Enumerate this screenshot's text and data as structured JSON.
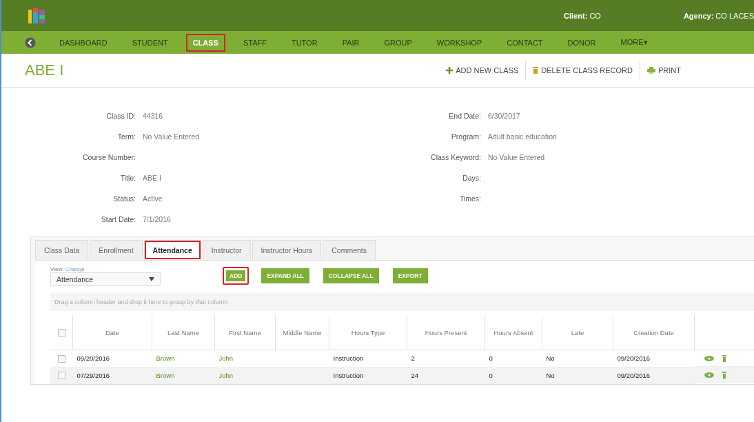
{
  "header": {
    "client_label": "Client:",
    "client": "CO",
    "agency_label": "Agency:",
    "agency": "CO LACES"
  },
  "nav": [
    {
      "label": "DASHBOARD",
      "selected": false,
      "highlighted": false
    },
    {
      "label": "STUDENT",
      "selected": false,
      "highlighted": false
    },
    {
      "label": "CLASS",
      "selected": true,
      "highlighted": true
    },
    {
      "label": "STAFF",
      "selected": false,
      "highlighted": false
    },
    {
      "label": "TUTOR",
      "selected": false,
      "highlighted": false
    },
    {
      "label": "PAIR",
      "selected": false,
      "highlighted": false
    },
    {
      "label": "GROUP",
      "selected": false,
      "highlighted": false
    },
    {
      "label": "WORKSHOP",
      "selected": false,
      "highlighted": false
    },
    {
      "label": "CONTACT",
      "selected": false,
      "highlighted": false
    },
    {
      "label": "DONOR",
      "selected": false,
      "highlighted": false
    },
    {
      "label": "MORE",
      "selected": false,
      "highlighted": false,
      "caret": "▾"
    }
  ],
  "page_title": "ABE I",
  "actions": [
    {
      "kind": "add",
      "label": "ADD NEW CLASS"
    },
    {
      "kind": "delete",
      "label": "DELETE CLASS RECORD"
    },
    {
      "kind": "print",
      "label": "PRINT"
    }
  ],
  "details_left": [
    {
      "label": "Class ID:",
      "value": "44316"
    },
    {
      "label": "Term:",
      "value": "No Value Entered"
    },
    {
      "label": "Course Number:"
    },
    {
      "label": "Title:",
      "value": "ABE I"
    },
    {
      "label": "Status:",
      "value": "Active"
    },
    {
      "label": "Start Date:",
      "value": "7/1/2016"
    }
  ],
  "details_right": [
    {
      "label": "End Date:",
      "value": "6/30/2017"
    },
    {
      "label": "Program:",
      "value": "Adult basic education"
    },
    {
      "label": "Class Keyword:",
      "value": "No Value Entered"
    },
    {
      "label": "Days:"
    },
    {
      "label": "Times:"
    }
  ],
  "tabs": [
    {
      "label": "Class Data",
      "selected": false,
      "highlighted": false
    },
    {
      "label": "Enrollment",
      "selected": false,
      "highlighted": false
    },
    {
      "label": "Attendance",
      "selected": true,
      "highlighted": true
    },
    {
      "label": "Instructor",
      "selected": false,
      "highlighted": false
    },
    {
      "label": "Instructor Hours",
      "selected": false,
      "highlighted": false
    },
    {
      "label": "Comments",
      "selected": false,
      "highlighted": false
    }
  ],
  "view": {
    "label": "View:",
    "link": "Change",
    "value": "Attendance"
  },
  "buttons": [
    {
      "label": "ADD",
      "highlighted": true
    },
    {
      "label": "EXPAND ALL",
      "highlighted": false
    },
    {
      "label": "COLLAPSE ALL",
      "highlighted": false
    },
    {
      "label": "EXPORT",
      "highlighted": false
    }
  ],
  "group_hint": "Drag a column header and drop it here to group by that column",
  "table": {
    "all_checked": false,
    "columns": [
      "Date",
      "Last Name",
      "First Name",
      "Middle Name",
      "Hours Type",
      "Hours Present",
      "Hours Absent",
      "Late",
      "Creation Date"
    ],
    "rows": [
      {
        "checked": false,
        "cells": [
          "09/20/2016",
          "Brown",
          "John",
          "",
          "Instruction",
          "2",
          "0",
          "No",
          "09/20/2016"
        ]
      },
      {
        "checked": false,
        "cells": [
          "07/29/2016",
          "Brown",
          "John",
          "",
          "Instruction",
          "24",
          "0",
          "No",
          "09/20/2016"
        ]
      }
    ]
  }
}
